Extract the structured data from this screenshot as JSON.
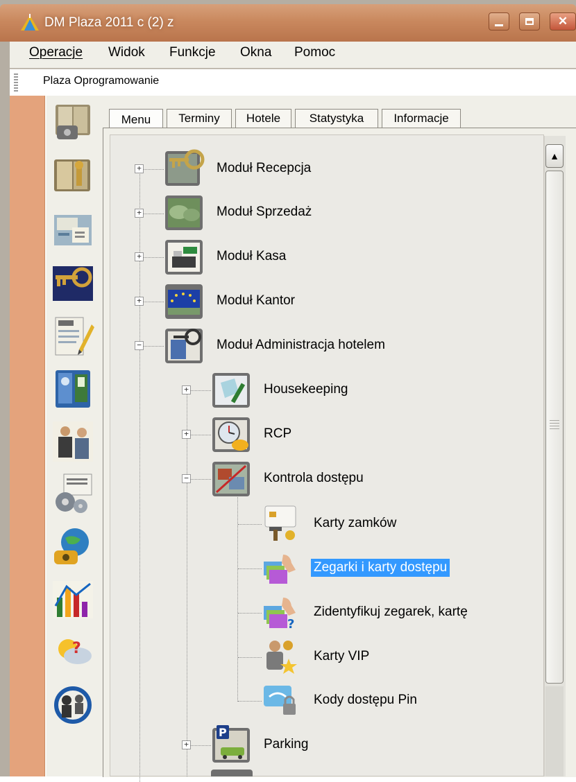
{
  "window": {
    "title": "DM Plaza 2011 c (2) z"
  },
  "menubar": {
    "items": [
      {
        "label": "Operacje"
      },
      {
        "label": "Widok"
      },
      {
        "label": "Funkcje"
      },
      {
        "label": "Okna"
      },
      {
        "label": "Pomoc"
      }
    ]
  },
  "addressbar": {
    "text": "Plaza Oprogramowanie"
  },
  "tabs": [
    {
      "label": "Menu"
    },
    {
      "label": "Terminy"
    },
    {
      "label": "Hotele"
    },
    {
      "label": "Statystyka"
    },
    {
      "label": "Informacje"
    }
  ],
  "tree": {
    "items": [
      {
        "label": "Moduł Recepcja",
        "level": 0,
        "expanded": false,
        "icon": "keys-icon"
      },
      {
        "label": "Moduł Sprzedaż",
        "level": 0,
        "expanded": false,
        "icon": "money-icon"
      },
      {
        "label": "Moduł Kasa",
        "level": 0,
        "expanded": false,
        "icon": "cash-register-icon"
      },
      {
        "label": "Moduł Kantor",
        "level": 0,
        "expanded": false,
        "icon": "euro-flag-icon"
      },
      {
        "label": "Moduł Administracja hotelem",
        "level": 0,
        "expanded": true,
        "icon": "admin-key-icon"
      },
      {
        "label": "Housekeeping",
        "level": 1,
        "expanded": false,
        "icon": "cleaning-icon"
      },
      {
        "label": "RCP",
        "level": 1,
        "expanded": false,
        "icon": "clock-helmet-icon"
      },
      {
        "label": "Kontrola dostępu",
        "level": 1,
        "expanded": true,
        "icon": "access-control-icon"
      },
      {
        "label": "Karty zamków",
        "level": 2,
        "icon": "lock-card-icon"
      },
      {
        "label": "Zegarki i karty dostępu",
        "level": 2,
        "icon": "access-cards-hand-icon",
        "selected": true
      },
      {
        "label": "Zidentyfikuj zegarek, kartę",
        "level": 2,
        "icon": "identify-card-icon"
      },
      {
        "label": "Karty VIP",
        "level": 2,
        "icon": "vip-card-icon"
      },
      {
        "label": "Kody dostępu Pin",
        "level": 2,
        "icon": "pin-code-icon"
      },
      {
        "label": "Parking",
        "level": 1,
        "expanded": false,
        "icon": "parking-icon"
      }
    ]
  },
  "colors": {
    "titlebar": "#c9885e",
    "accent_stripe": "#e4a37c",
    "selection": "#3399ff",
    "panel": "#f0efe8"
  }
}
